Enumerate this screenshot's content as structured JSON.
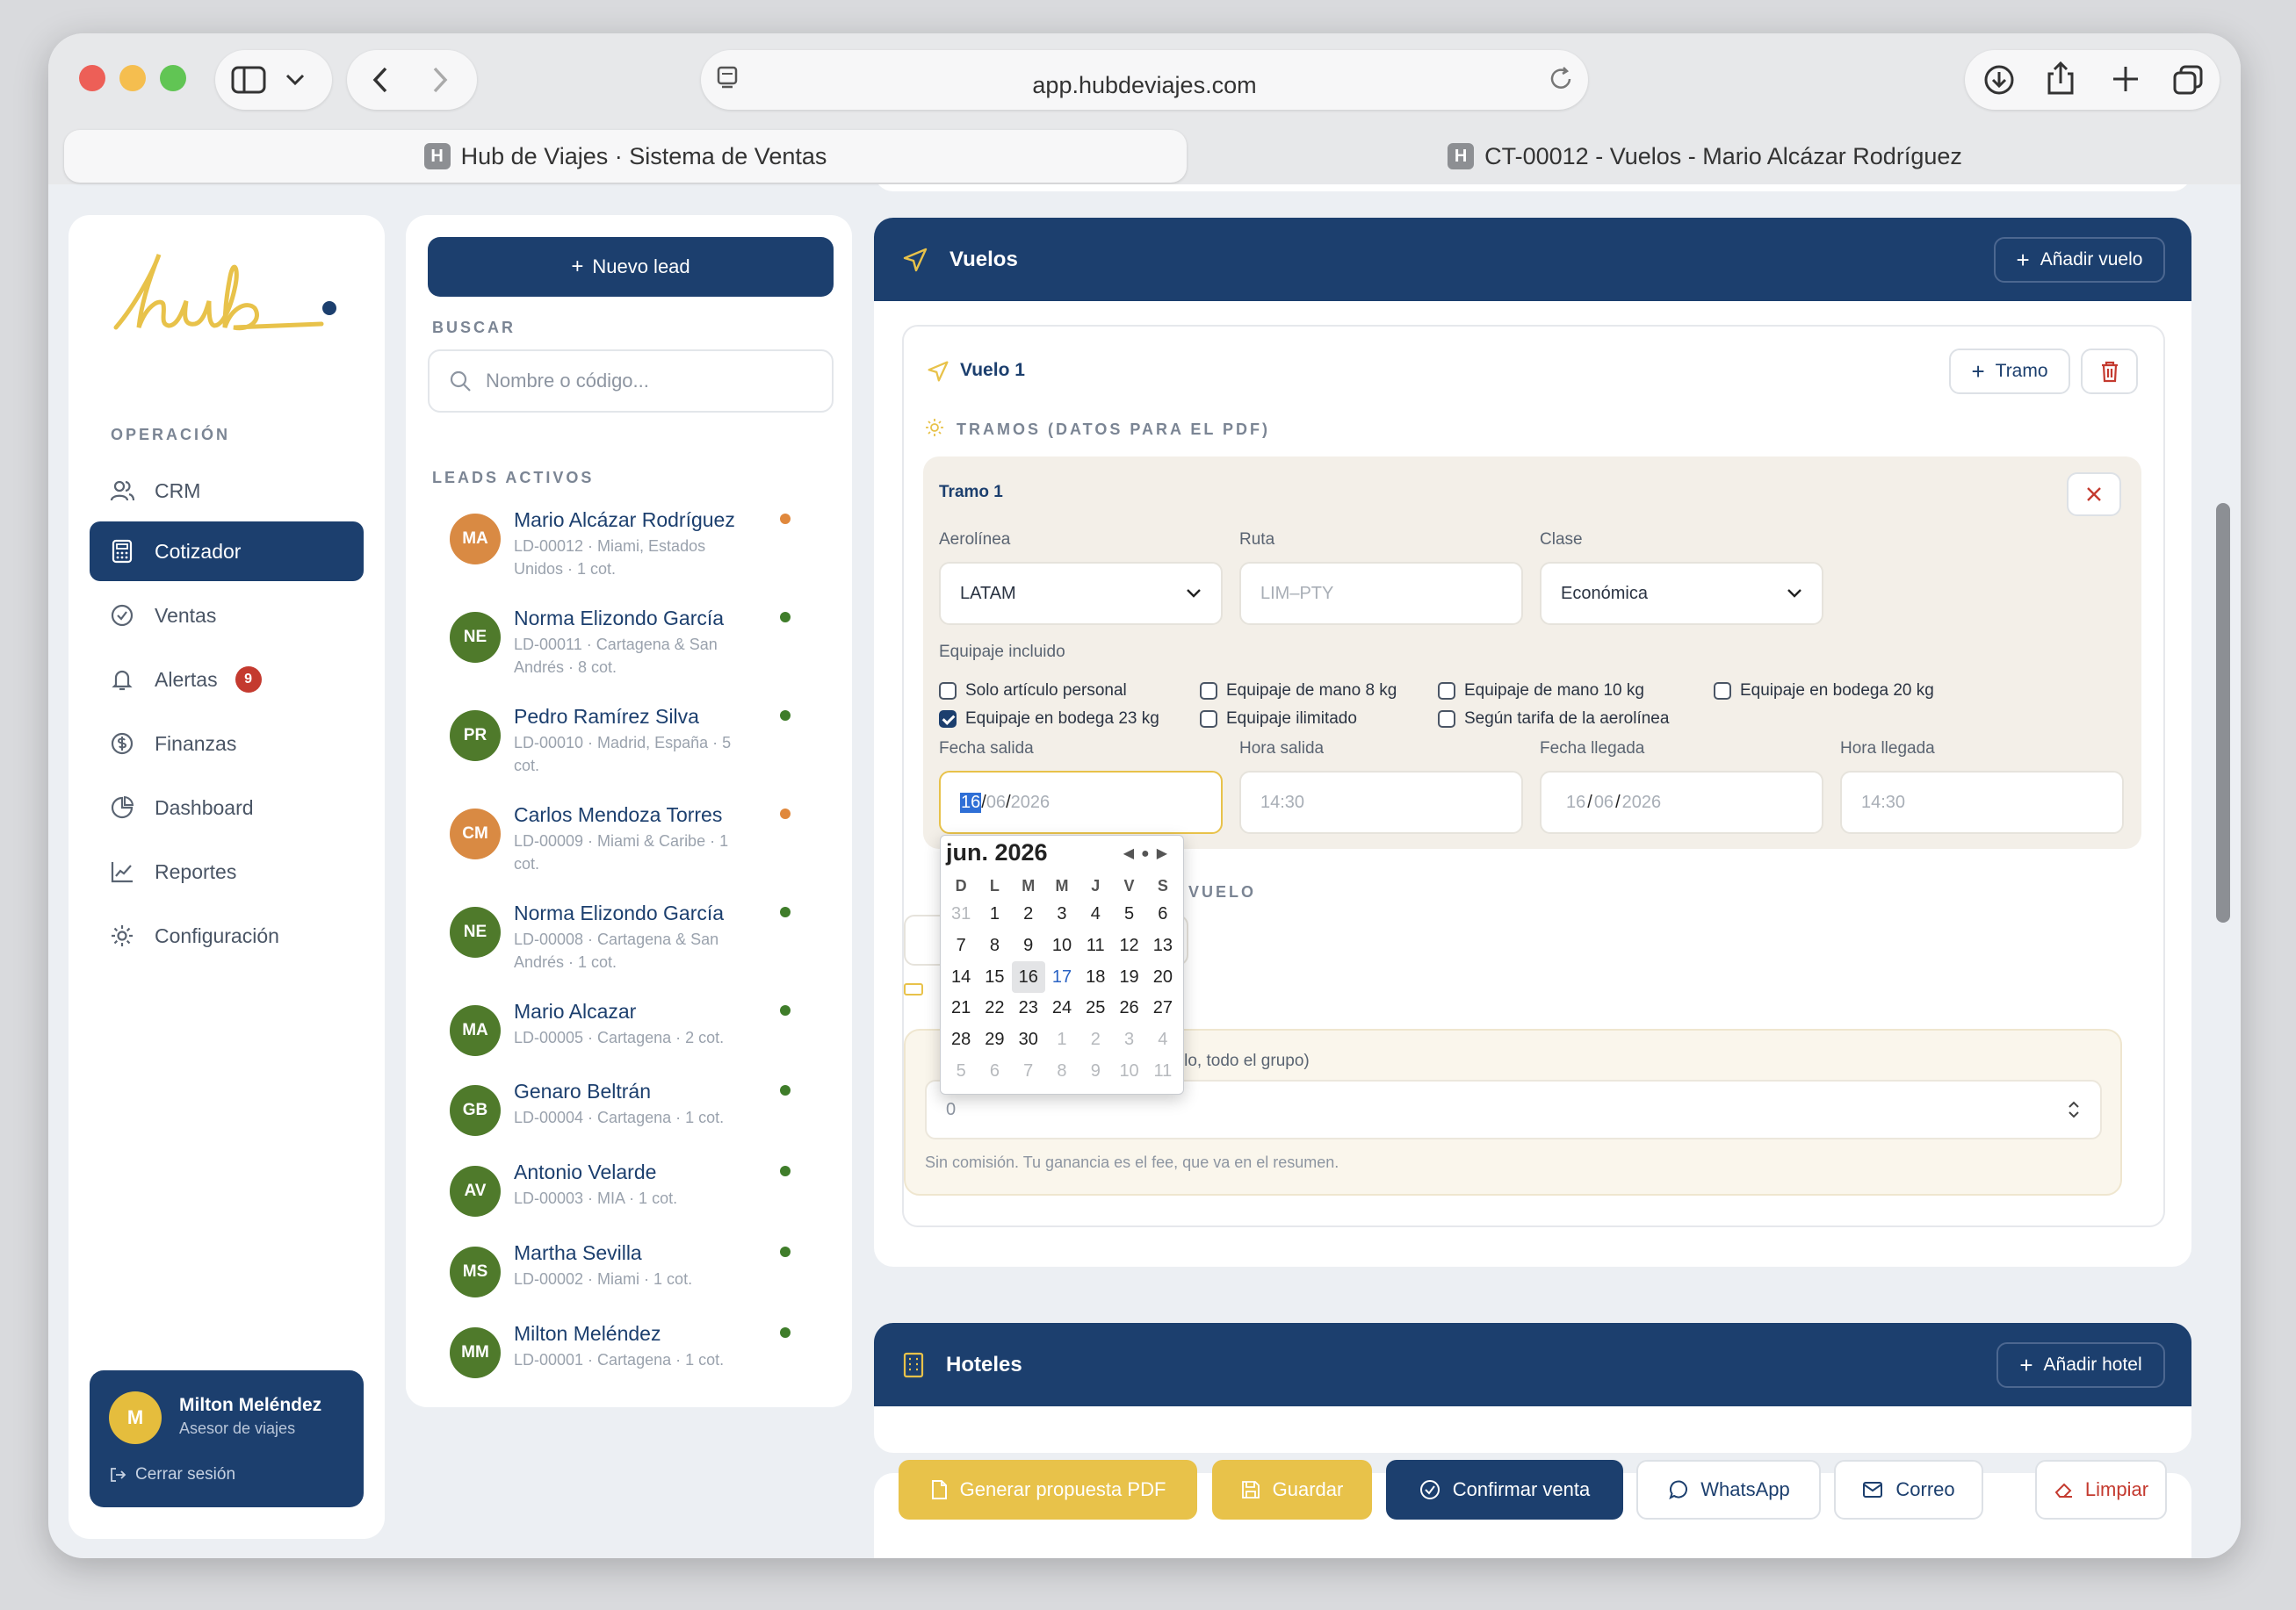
{
  "browser": {
    "url": "app.hubdeviajes.com",
    "tabs": [
      {
        "label": "Hub de Viajes · Sistema de Ventas",
        "favicon": "H"
      },
      {
        "label": "CT-00012 - Vuelos - Mario Alcázar Rodríguez",
        "favicon": "H"
      }
    ]
  },
  "sidebar": {
    "section": "OPERACIÓN",
    "items": [
      {
        "label": "CRM",
        "icon": "users-icon"
      },
      {
        "label": "Cotizador",
        "icon": "calculator-icon"
      },
      {
        "label": "Ventas",
        "icon": "check-circle-icon"
      },
      {
        "label": "Alertas",
        "icon": "bell-icon",
        "badge": "9"
      },
      {
        "label": "Finanzas",
        "icon": "dollar-icon"
      },
      {
        "label": "Dashboard",
        "icon": "pie-chart-icon"
      },
      {
        "label": "Reportes",
        "icon": "line-chart-icon"
      },
      {
        "label": "Configuración",
        "icon": "gear-icon"
      }
    ],
    "user": {
      "initial": "M",
      "name": "Milton Meléndez",
      "role": "Asesor de viajes",
      "logout": "Cerrar sesión"
    }
  },
  "leads": {
    "new_button": "Nuevo lead",
    "search_label": "BUSCAR",
    "search_placeholder": "Nombre o código...",
    "active_label": "LEADS ACTIVOS",
    "items": [
      {
        "initials": "MA",
        "name": "Mario Alcázar Rodríguez",
        "sub": "LD-00012 · Miami, Estados Unidos · 1 cot.",
        "avatar_color": "#d98a43",
        "dot": "#e0883c"
      },
      {
        "initials": "NE",
        "name": "Norma Elizondo García",
        "sub": "LD-00011 · Cartagena & San Andrés · 8 cot.",
        "avatar_color": "#4f7a2b",
        "dot": "#3f7d2a"
      },
      {
        "initials": "PR",
        "name": "Pedro Ramírez Silva",
        "sub": "LD-00010 · Madrid, España · 5 cot.",
        "avatar_color": "#4f7a2b",
        "dot": "#3f7d2a"
      },
      {
        "initials": "CM",
        "name": "Carlos Mendoza Torres",
        "sub": "LD-00009 · Miami & Caribe · 1 cot.",
        "avatar_color": "#d98a43",
        "dot": "#e0883c"
      },
      {
        "initials": "NE",
        "name": "Norma Elizondo García",
        "sub": "LD-00008 · Cartagena & San Andrés · 1 cot.",
        "avatar_color": "#4f7a2b",
        "dot": "#3f7d2a"
      },
      {
        "initials": "MA",
        "name": "Mario Alcazar",
        "sub": "LD-00005 · Cartagena · 2 cot.",
        "avatar_color": "#4f7a2b",
        "dot": "#3f7d2a"
      },
      {
        "initials": "GB",
        "name": "Genaro Beltrán",
        "sub": "LD-00004 · Cartagena · 1 cot.",
        "avatar_color": "#4f7a2b",
        "dot": "#3f7d2a"
      },
      {
        "initials": "AV",
        "name": "Antonio Velarde",
        "sub": "LD-00003 · MIA · 1 cot.",
        "avatar_color": "#4f7a2b",
        "dot": "#3f7d2a"
      },
      {
        "initials": "MS",
        "name": "Martha Sevilla",
        "sub": "LD-00002 · Miami · 1 cot.",
        "avatar_color": "#4f7a2b",
        "dot": "#3f7d2a"
      },
      {
        "initials": "MM",
        "name": "Milton Meléndez",
        "sub": "LD-00001 · Cartagena · 1 cot.",
        "avatar_color": "#4f7a2b",
        "dot": "#3f7d2a"
      }
    ]
  },
  "vuelos": {
    "title": "Vuelos",
    "add_button": "Añadir vuelo",
    "flight": {
      "title": "Vuelo 1",
      "tramo_button": "Tramo",
      "tramos_label": "TRAMOS (DATOS PARA EL PDF)",
      "tramo": {
        "title": "Tramo 1",
        "aerolinea_label": "Aerolínea",
        "aerolinea_value": "LATAM",
        "ruta_label": "Ruta",
        "ruta_placeholder": "LIM–PTY",
        "clase_label": "Clase",
        "clase_value": "Económica",
        "equipaje_label": "Equipaje incluido",
        "equipaje": [
          {
            "label": "Solo artículo personal",
            "checked": false
          },
          {
            "label": "Equipaje de mano 8 kg",
            "checked": false
          },
          {
            "label": "Equipaje de mano 10 kg",
            "checked": false
          },
          {
            "label": "Equipaje en bodega 20 kg",
            "checked": false
          },
          {
            "label": "Equipaje en bodega 23 kg",
            "checked": true
          },
          {
            "label": "Equipaje ilimitado",
            "checked": false
          },
          {
            "label": "Según tarifa de la aerolínea",
            "checked": false
          }
        ],
        "fecha_salida_label": "Fecha salida",
        "fecha_salida": {
          "day": "16",
          "month": "06",
          "year": "2026"
        },
        "hora_salida_label": "Hora salida",
        "hora_salida_placeholder": "14:30",
        "fecha_llegada_label": "Fecha llegada",
        "fecha_llegada": {
          "day": "16",
          "month": "06",
          "year": "2026"
        },
        "hora_llegada_label": "Hora llegada",
        "hora_llegada_placeholder": "14:30"
      },
      "hidden_section_tail": "VUELO",
      "fee_label_tail": "uelo, todo el grupo)",
      "fee_value": "0",
      "fee_hint": "Sin comisión. Tu ganancia es el fee, que va en el resumen."
    }
  },
  "calendar": {
    "title": "jun. 2026",
    "weekdays": [
      "D",
      "L",
      "M",
      "M",
      "J",
      "V",
      "S"
    ],
    "days": [
      [
        "31",
        "1",
        "2",
        "3",
        "4",
        "5",
        "6"
      ],
      [
        "7",
        "8",
        "9",
        "10",
        "11",
        "12",
        "13"
      ],
      [
        "14",
        "15",
        "16",
        "17",
        "18",
        "19",
        "20"
      ],
      [
        "21",
        "22",
        "23",
        "24",
        "25",
        "26",
        "27"
      ],
      [
        "28",
        "29",
        "30",
        "1",
        "2",
        "3",
        "4"
      ],
      [
        "5",
        "6",
        "7",
        "8",
        "9",
        "10",
        "11"
      ]
    ]
  },
  "hoteles": {
    "title": "Hoteles",
    "add_button": "Añadir hotel"
  },
  "actions": {
    "pdf": "Generar propuesta PDF",
    "save": "Guardar",
    "confirm": "Confirmar venta",
    "whatsapp": "WhatsApp",
    "email": "Correo",
    "clear": "Limpiar"
  },
  "colors": {
    "navy": "#1c3f6e",
    "yellow": "#e8c24a",
    "red": "#c43a2f",
    "beige": "#f3efe8"
  }
}
